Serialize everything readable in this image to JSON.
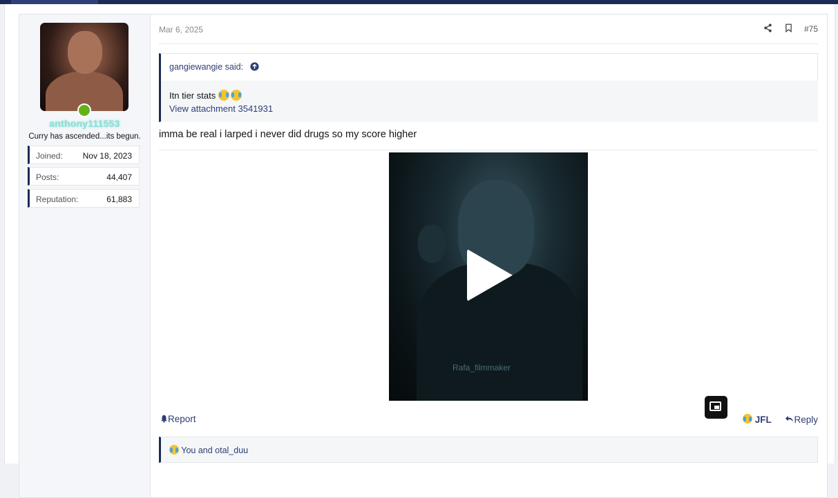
{
  "post": {
    "date": "Mar 6, 2025",
    "number": "#75",
    "message": "imma be real i larped i never did drugs so my score higher"
  },
  "user": {
    "name": "anthony111553",
    "title": "Curry has ascended...its begun.",
    "stats": [
      {
        "key": "Joined:",
        "value": "Nov 18, 2023"
      },
      {
        "key": "Posts:",
        "value": "44,407"
      },
      {
        "key": "Reputation:",
        "value": "61,883"
      }
    ]
  },
  "quote": {
    "author": "gangiewangie said:",
    "text": "Itn tier stats",
    "attachment": "View attachment 3541931"
  },
  "video": {
    "watermark": "Rafa_filmmaker"
  },
  "actions": {
    "report": "Report",
    "react": "JFL",
    "reply": "Reply"
  },
  "reactions": {
    "summary": "You and otal_duu"
  },
  "icons": {
    "share": "share-icon",
    "bookmark": "bookmark-icon",
    "goto": "arrow-up-circle-icon",
    "bell": "bell-icon",
    "reply": "reply-icon",
    "pip": "picture-in-picture-icon",
    "emoji": "crying-laughing-emoji"
  },
  "colors": {
    "accent": "#1c2a56",
    "link": "#2d3e75",
    "username": "#8be0d6",
    "online": "#63b21b"
  }
}
